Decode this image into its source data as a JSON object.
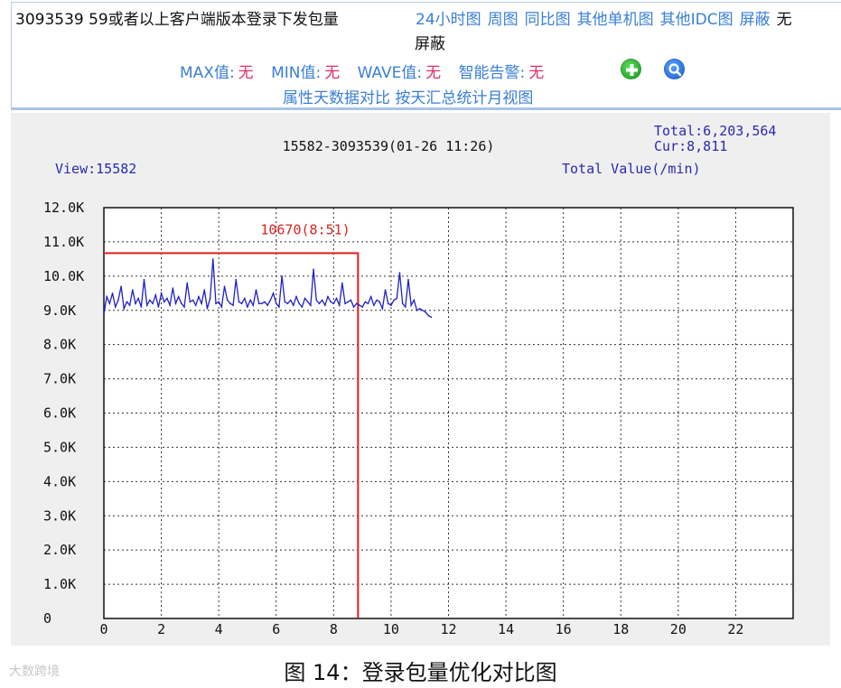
{
  "header": {
    "metric_name": "3093539 59或者以上客户端版本登录下发包量",
    "nav_links": [
      "24小时图",
      "周图",
      "同比图",
      "其他单机图",
      "其他IDC图",
      "屏蔽"
    ],
    "nav_overflow": "无",
    "nav_wrap": "屏蔽",
    "stats": [
      {
        "label": "MAX值:",
        "value": "无"
      },
      {
        "label": "MIN值:",
        "value": "无"
      },
      {
        "label": "WAVE值:",
        "value": "无"
      },
      {
        "label": "智能告警:",
        "value": "无"
      }
    ],
    "links_row2": "属性天数据对比 按天汇总统计月视图",
    "colors": {
      "link": "#3a7fd5",
      "value": "#e0306a"
    },
    "icons": [
      "plus-circle-icon",
      "magnifier-icon"
    ]
  },
  "chart_data": {
    "type": "line",
    "title": "15582-3093539(01-26 11:26)",
    "view_label": "View:15582",
    "total_label": "Total:6,203,564",
    "cur_label": "Cur:8,811",
    "ylabel": "Total Value(/min)",
    "xlim": [
      0,
      24
    ],
    "ylim": [
      0,
      12000
    ],
    "x_ticks": [
      0,
      2,
      4,
      6,
      8,
      10,
      12,
      14,
      16,
      18,
      20,
      22
    ],
    "y_tick_labels": [
      "0",
      "1.0K",
      "2.0K",
      "3.0K",
      "4.0K",
      "5.0K",
      "6.0K",
      "7.0K",
      "8.0K",
      "9.0K",
      "10.0K",
      "11.0K",
      "12.0K"
    ],
    "grid": true,
    "marker": {
      "label": "10670(8:51)",
      "x": 8.85,
      "y": 10670,
      "color": "#e02020"
    },
    "series": [
      {
        "color": "#2020c8",
        "x": [
          0.0,
          0.1,
          0.2,
          0.3,
          0.4,
          0.5,
          0.6,
          0.7,
          0.8,
          0.9,
          1.0,
          1.1,
          1.2,
          1.3,
          1.4,
          1.5,
          1.6,
          1.7,
          1.8,
          1.9,
          2.0,
          2.1,
          2.2,
          2.3,
          2.4,
          2.5,
          2.6,
          2.7,
          2.8,
          2.9,
          3.0,
          3.1,
          3.2,
          3.3,
          3.4,
          3.5,
          3.6,
          3.7,
          3.8,
          3.9,
          4.0,
          4.1,
          4.2,
          4.3,
          4.4,
          4.5,
          4.6,
          4.7,
          4.8,
          4.9,
          5.0,
          5.1,
          5.2,
          5.3,
          5.4,
          5.5,
          5.6,
          5.7,
          5.8,
          5.9,
          6.0,
          6.1,
          6.2,
          6.3,
          6.4,
          6.5,
          6.6,
          6.7,
          6.8,
          6.9,
          7.0,
          7.1,
          7.2,
          7.3,
          7.4,
          7.5,
          7.6,
          7.7,
          7.8,
          7.9,
          8.0,
          8.1,
          8.2,
          8.3,
          8.4,
          8.5,
          8.6,
          8.7,
          8.8,
          8.9,
          9.0,
          9.1,
          9.2,
          9.3,
          9.4,
          9.5,
          9.6,
          9.7,
          9.8,
          9.9,
          10.0,
          10.1,
          10.2,
          10.3,
          10.4,
          10.5,
          10.6,
          10.7,
          10.8,
          10.9,
          11.0,
          11.1,
          11.2,
          11.3,
          11.4
        ],
        "values": [
          8900,
          9400,
          9200,
          9500,
          9100,
          9300,
          9700,
          9050,
          9250,
          9150,
          9600,
          9200,
          9350,
          9100,
          9900,
          9150,
          9300,
          9200,
          9450,
          9100,
          9500,
          9250,
          9350,
          9150,
          9650,
          9200,
          9400,
          9200,
          9100,
          9800,
          9250,
          9300,
          9150,
          9400,
          9200,
          9600,
          9050,
          9350,
          10500,
          9200,
          9250,
          9100,
          9700,
          9300,
          9200,
          9150,
          9900,
          9250,
          9200,
          9350,
          9100,
          9300,
          9150,
          9600,
          9200,
          9200,
          9250,
          9150,
          9300,
          9500,
          9200,
          9100,
          10000,
          9250,
          9200,
          9300,
          9150,
          9400,
          9200,
          9100,
          9350,
          9250,
          9150,
          10200,
          9300,
          9200,
          9300,
          9150,
          9400,
          9250,
          9200,
          9350,
          9150,
          9800,
          9200,
          9250,
          9300,
          9100,
          9200,
          9150,
          9100,
          9250,
          9200,
          9400,
          9150,
          9300,
          9250,
          9050,
          9600,
          9200,
          9150,
          9300,
          9350,
          10100,
          9200,
          9100,
          9900,
          9150,
          9300,
          9000,
          9050,
          9000,
          8950,
          8850,
          8800
        ]
      }
    ]
  },
  "caption": "图 14：登录包量优化对比图",
  "watermark": "大数跨境"
}
